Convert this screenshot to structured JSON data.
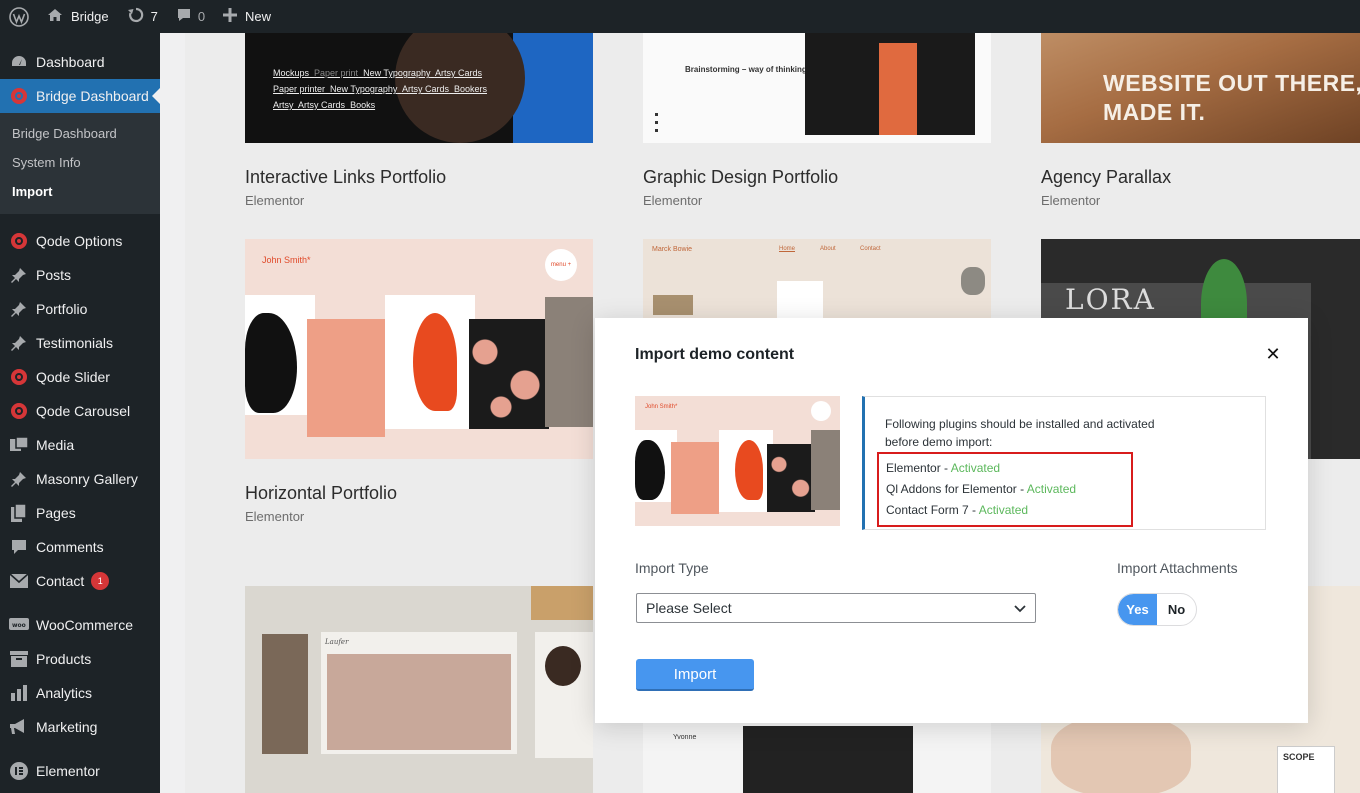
{
  "adminbar": {
    "site_name": "Bridge",
    "updates_count": "7",
    "comments_count": "0",
    "new_label": "New"
  },
  "sidebar": {
    "top_items": [
      {
        "label": "Dashboard",
        "icon": "dashboard-icon"
      },
      {
        "label": "Bridge Dashboard",
        "icon": "qode-icon"
      }
    ],
    "submenu": [
      "Bridge Dashboard",
      "System Info",
      "Import"
    ],
    "items": [
      {
        "label": "Qode Options",
        "icon": "qode-icon"
      },
      {
        "label": "Posts",
        "icon": "pin-icon"
      },
      {
        "label": "Portfolio",
        "icon": "pin-icon"
      },
      {
        "label": "Testimonials",
        "icon": "pin-icon"
      },
      {
        "label": "Qode Slider",
        "icon": "qode-icon"
      },
      {
        "label": "Qode Carousel",
        "icon": "qode-icon"
      },
      {
        "label": "Media",
        "icon": "media-icon"
      },
      {
        "label": "Masonry Gallery",
        "icon": "pin-icon"
      },
      {
        "label": "Pages",
        "icon": "pages-icon"
      },
      {
        "label": "Comments",
        "icon": "comment-icon"
      },
      {
        "label": "Contact",
        "icon": "mail-icon",
        "badge": "1"
      }
    ],
    "items2": [
      {
        "label": "WooCommerce",
        "icon": "woo-icon"
      },
      {
        "label": "Products",
        "icon": "archive-icon"
      },
      {
        "label": "Analytics",
        "icon": "bar-chart-icon"
      },
      {
        "label": "Marketing",
        "icon": "megaphone-icon"
      }
    ],
    "items3": [
      {
        "label": "Elementor",
        "icon": "elementor-icon"
      }
    ]
  },
  "demos": [
    {
      "title": "Interactive Links Portfolio",
      "builder": "Elementor",
      "thumb_links": [
        "Mockups",
        "Paper print",
        "New Typography",
        "Artsy Cards",
        "Paper printer",
        "New Typography",
        "Artsy Cards",
        "Bookers",
        "Artsy",
        "Artsy Cards",
        "Books"
      ]
    },
    {
      "title": "Graphic Design Portfolio",
      "builder": "Elementor",
      "thumb_caption": "Brainstorming – way of thinking"
    },
    {
      "title": "Agency Parallax",
      "builder": "Elementor",
      "thumb_caption": "WEBSITE OUT THERE, WE MADE IT."
    },
    {
      "title": "Horizontal Portfolio",
      "builder": "Elementor",
      "thumb_name": "John Smith*",
      "thumb_menu": "menu +"
    },
    {
      "thumb_name": "Marck Bowie",
      "thumb_nav": [
        "Home",
        "About",
        "Contact"
      ]
    },
    {
      "thumb_name": "LORA"
    },
    {
      "thumb_name": "Laufer"
    },
    {
      "thumb_name": "Yvonne"
    },
    {
      "thumb_name": "SCOPE"
    }
  ],
  "modal": {
    "title": "Import demo content",
    "close_symbol": "✕",
    "plugins_intro": "Following plugins should be installed and activated before demo import:",
    "plugins": [
      {
        "name": "Elementor",
        "status": "Activated"
      },
      {
        "name": "Ql Addons for Elementor",
        "status": "Activated"
      },
      {
        "name": "Contact Form 7",
        "status": "Activated"
      }
    ],
    "import_type_label": "Import Type",
    "import_type_value": "Please Select",
    "attachments_label": "Import Attachments",
    "toggle_yes": "Yes",
    "toggle_no": "No",
    "import_button": "Import"
  },
  "colors": {
    "admin_dark": "#1d2327",
    "active_blue": "#2271b1",
    "qode_red": "#d63638",
    "button_blue": "#4796ef",
    "activated_green": "#5cb85c",
    "highlight_red": "#d81c1c"
  }
}
